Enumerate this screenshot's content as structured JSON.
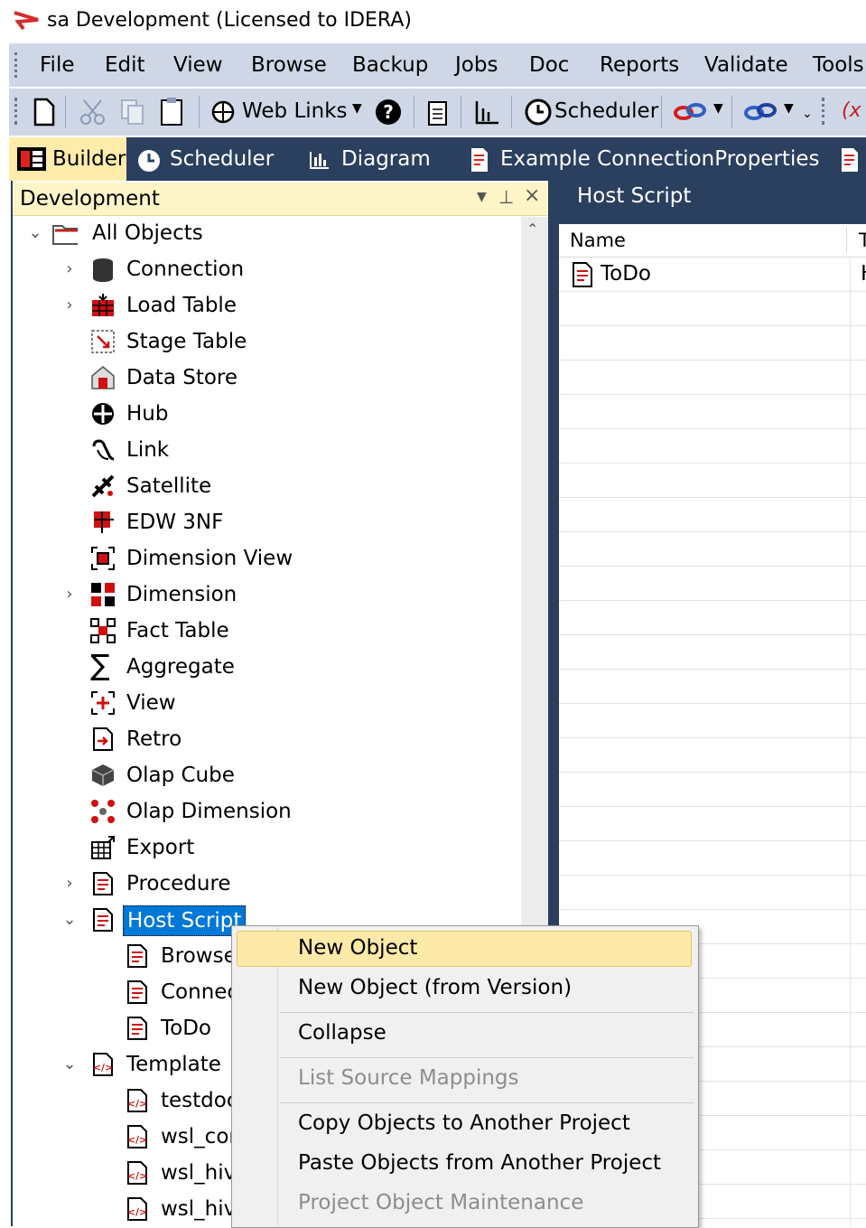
{
  "window": {
    "title": "sa  Development  (Licensed to IDERA)"
  },
  "menubar": {
    "items": [
      "File",
      "Edit",
      "View",
      "Browse",
      "Backup",
      "Jobs",
      "Doc",
      "Reports",
      "Validate",
      "Tools"
    ]
  },
  "toolbar": {
    "web_links": "Web Links",
    "scheduler": "Scheduler"
  },
  "tabs": [
    "Builder",
    "Scheduler",
    "Diagram",
    "Example ConnectionProperties"
  ],
  "left_panel": {
    "title": "Development",
    "root": "All Objects",
    "items": [
      "Connection",
      "Load Table",
      "Stage Table",
      "Data Store",
      "Hub",
      "Link",
      "Satellite",
      "EDW 3NF",
      "Dimension View",
      "Dimension",
      "Fact Table",
      "Aggregate",
      "View",
      "Retro",
      "Olap Cube",
      "Olap Dimension",
      "Export",
      "Procedure",
      "Host Script"
    ],
    "host_script_children": [
      "Browse",
      "Connec",
      "ToDo"
    ],
    "template_label": "Template",
    "template_children": [
      "testdoc",
      "wsl_cor",
      "wsl_hiv",
      "wsl_hiv"
    ]
  },
  "right_panel": {
    "title": "Host Script",
    "column_name": "Name",
    "column_t": "T",
    "rows": [
      {
        "name": "ToDo",
        "t": "H"
      }
    ]
  },
  "context_menu": {
    "items": [
      "New Object",
      "New Object (from Version)",
      "Collapse",
      "List Source Mappings",
      "Copy Objects to Another Project",
      "Paste Objects from Another Project",
      "Project Object Maintenance"
    ]
  },
  "colors": {
    "navy": "#2b3f5f",
    "selection": "#0078d7",
    "highlight": "#fde9a8",
    "menubar": "#cfd7e6"
  }
}
